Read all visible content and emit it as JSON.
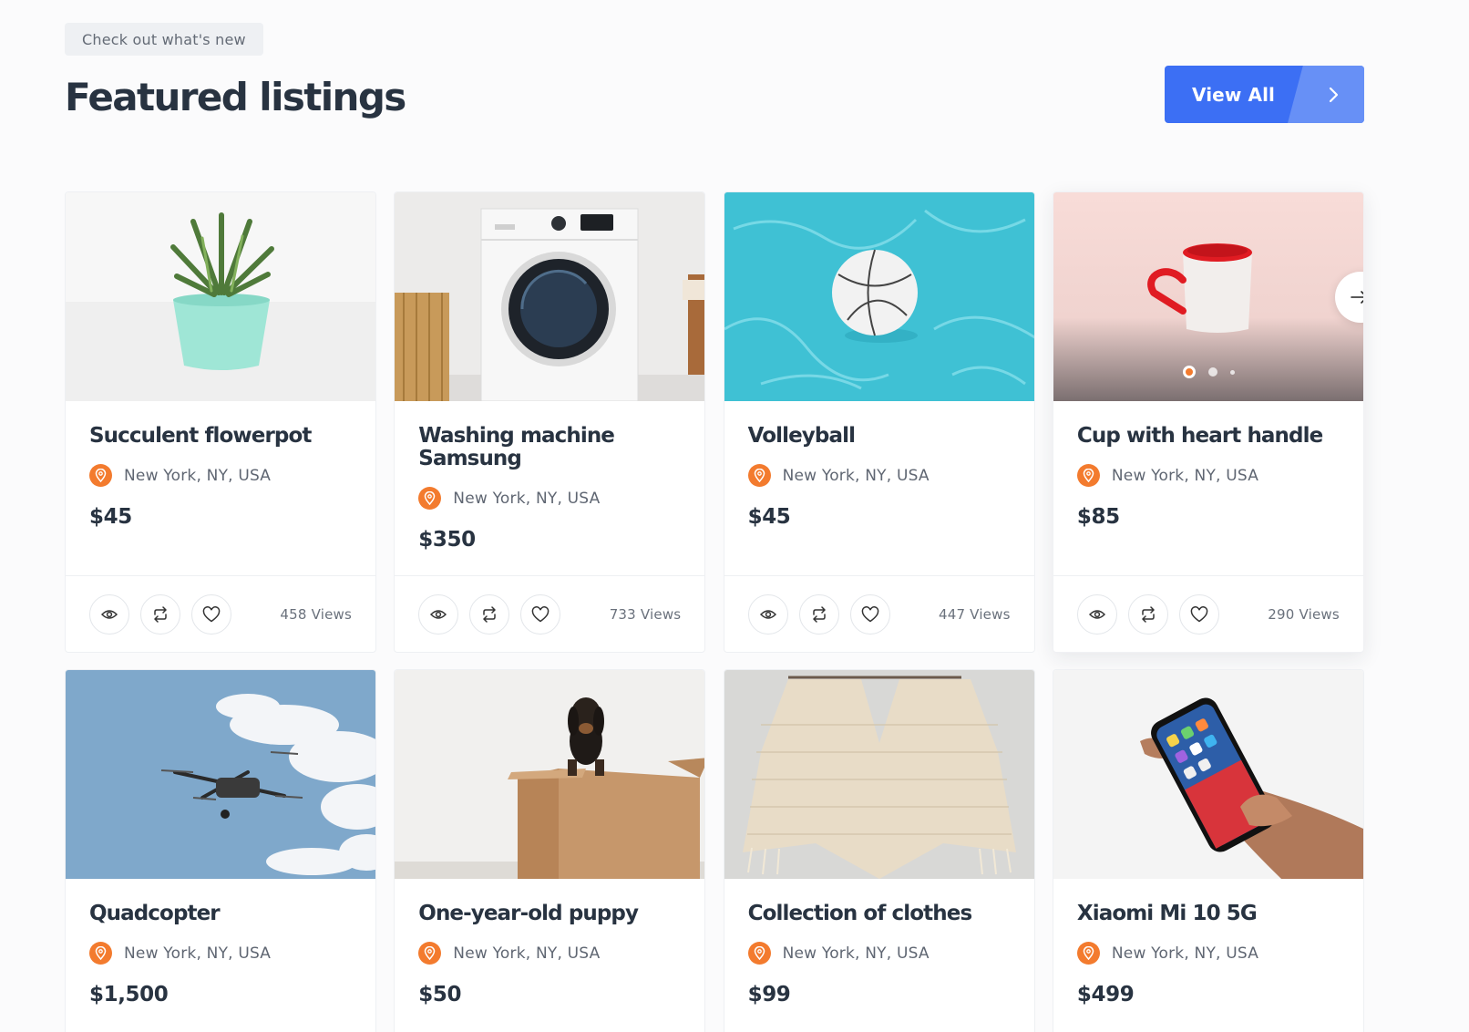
{
  "header": {
    "eyebrow": "Check out what's new",
    "title": "Featured listings",
    "view_all_label": "View All"
  },
  "colors": {
    "primary": "#3c6ff4",
    "accent": "#f37b2e",
    "heading": "#283341",
    "muted": "#5f6672"
  },
  "listings": [
    {
      "title": "Succulent flowerpot",
      "location": "New York, NY, USA",
      "price": "$45",
      "views": "458 Views",
      "image": "succulent-flowerpot-photo"
    },
    {
      "title": "Washing machine Samsung",
      "location": "New York, NY, USA",
      "price": "$350",
      "views": "733 Views",
      "image": "washing-machine-photo"
    },
    {
      "title": "Volleyball",
      "location": "New York, NY, USA",
      "price": "$45",
      "views": "447 Views",
      "image": "volleyball-in-pool-photo"
    },
    {
      "title": "Cup with heart handle",
      "location": "New York, NY, USA",
      "price": "$85",
      "views": "290 Views",
      "image": "heart-handle-cup-photo",
      "carousel": {
        "slides": 3,
        "active_slide": 1
      }
    },
    {
      "title": "Quadcopter",
      "location": "New York, NY, USA",
      "price": "$1,500",
      "image": "drone-in-sky-photo"
    },
    {
      "title": "One-year-old puppy",
      "location": "New York, NY, USA",
      "price": "$50",
      "image": "puppy-in-box-photo"
    },
    {
      "title": "Collection of clothes",
      "location": "New York, NY, USA",
      "price": "$99",
      "image": "knitted-top-photo"
    },
    {
      "title": "Xiaomi Mi 10 5G",
      "location": "New York, NY, USA",
      "price": "$499",
      "image": "phone-in-hand-photo"
    }
  ],
  "icons": {
    "location": "map-pin-icon",
    "quick_view": "eye-icon",
    "compare": "compare-arrows-icon",
    "favorite": "heart-icon",
    "view_all_arrow": "chevron-right-icon",
    "slider_next": "arrow-right-icon"
  }
}
